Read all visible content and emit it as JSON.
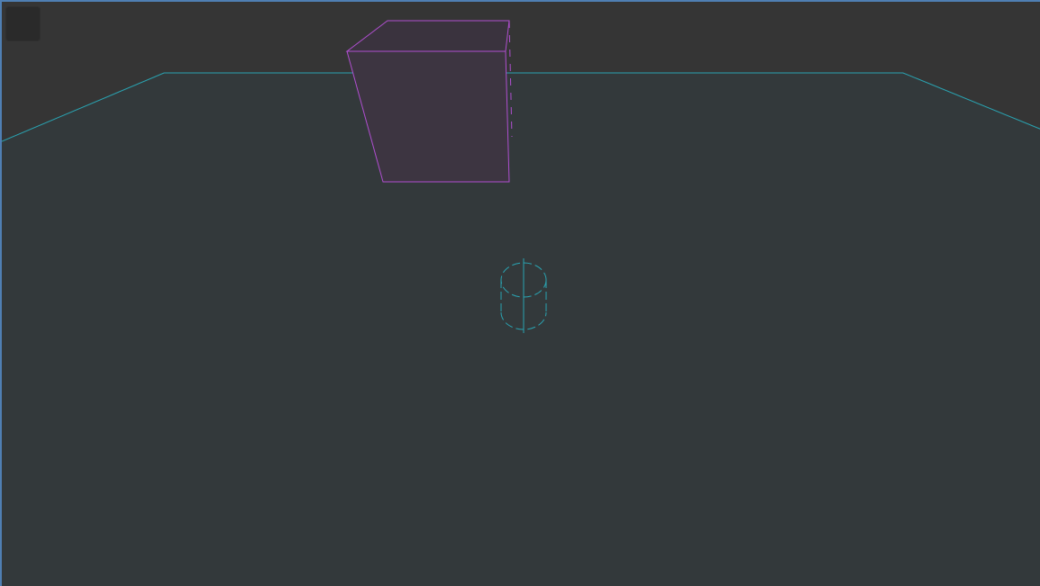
{
  "viewport": {
    "background": "#353535",
    "border_color": "#4f7fb3",
    "floor_fill": "#33393b",
    "floor_edge_color": "#2aa4b2",
    "menu_button_icon": "viewport-menu-icon"
  },
  "objects": [
    {
      "name": "box-mesh",
      "type": "box",
      "edge_color": "#b04fd0",
      "fill_color": "#3d3541"
    },
    {
      "name": "cylinder-gizmo",
      "type": "cylinder",
      "edge_color": "#2aa4b2"
    }
  ]
}
